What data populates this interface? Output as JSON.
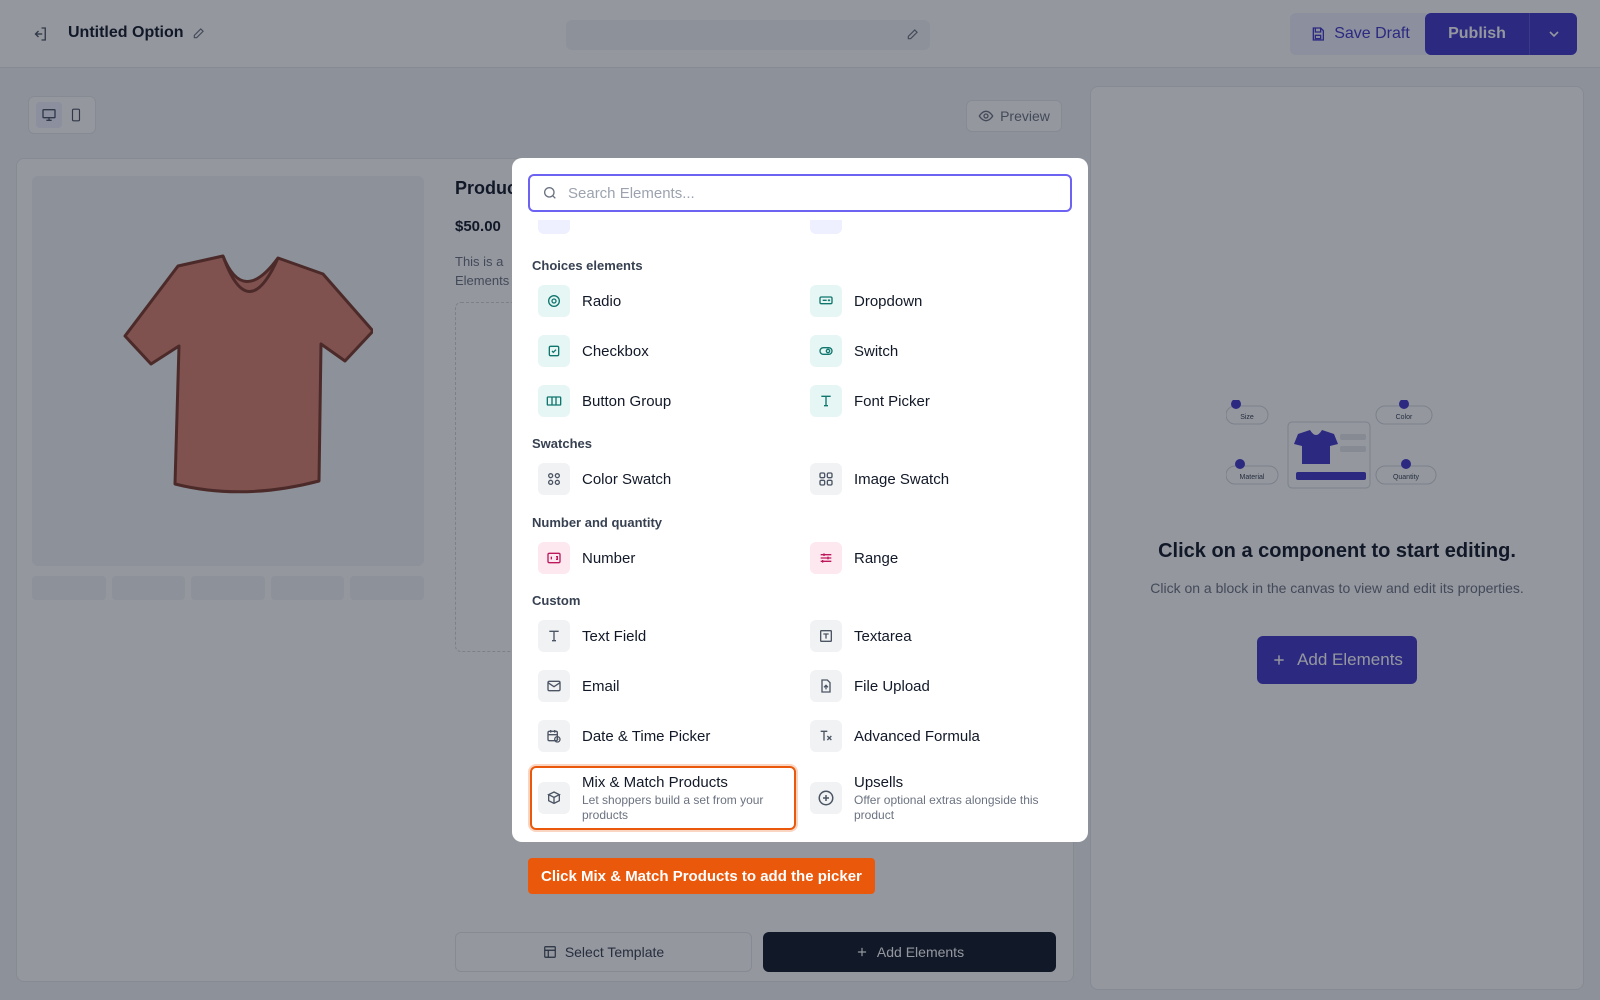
{
  "header": {
    "title": "Untitled Option",
    "save_draft_label": "Save Draft",
    "publish_label": "Publish"
  },
  "canvas": {
    "preview_label": "Preview",
    "product_title": "Produc",
    "product_price": "$50.00",
    "product_desc_line1": "This is a",
    "product_desc_line2": "Elements",
    "select_template_label": "Select Template",
    "add_elements_label": "Add Elements"
  },
  "right_panel": {
    "empty_title": "Click on a component to start editing.",
    "empty_subtitle": "Click on a block in the canvas to view and edit its properties.",
    "add_elements_label": "Add Elements",
    "illustration_labels": {
      "size": "Size",
      "color": "Color",
      "material": "Material",
      "quantity": "Quantity"
    }
  },
  "modal": {
    "search_placeholder": "Search Elements...",
    "sections": [
      {
        "label": "Choices elements",
        "items": [
          {
            "label": "Radio",
            "icon": "radio-icon"
          },
          {
            "label": "Dropdown",
            "icon": "dropdown-icon"
          },
          {
            "label": "Checkbox",
            "icon": "checkbox-icon"
          },
          {
            "label": "Switch",
            "icon": "switch-icon"
          },
          {
            "label": "Button Group",
            "icon": "button-group-icon"
          },
          {
            "label": "Font Picker",
            "icon": "font-picker-icon"
          }
        ]
      },
      {
        "label": "Swatches",
        "items": [
          {
            "label": "Color Swatch",
            "icon": "color-swatch-icon"
          },
          {
            "label": "Image Swatch",
            "icon": "image-swatch-icon"
          }
        ]
      },
      {
        "label": "Number and quantity",
        "items": [
          {
            "label": "Number",
            "icon": "number-icon"
          },
          {
            "label": "Range",
            "icon": "range-icon"
          }
        ]
      },
      {
        "label": "Custom",
        "items": [
          {
            "label": "Text Field",
            "icon": "text-field-icon"
          },
          {
            "label": "Textarea",
            "icon": "textarea-icon"
          },
          {
            "label": "Email",
            "icon": "email-icon"
          },
          {
            "label": "File Upload",
            "icon": "file-upload-icon"
          },
          {
            "label": "Date & Time Picker",
            "icon": "date-time-icon"
          },
          {
            "label": "Advanced Formula",
            "icon": "formula-icon"
          },
          {
            "label": "Mix & Match Products",
            "icon": "mix-match-icon",
            "description": "Let shoppers build a set from your products"
          },
          {
            "label": "Upsells",
            "icon": "upsells-icon",
            "description": "Offer optional extras alongside this product"
          }
        ]
      }
    ]
  },
  "tooltip": {
    "text": "Click Mix & Match Products to add the picker"
  },
  "colors": {
    "accent": "#4338ca",
    "highlight": "#ea580c",
    "search_focus": "#6d63f2"
  }
}
